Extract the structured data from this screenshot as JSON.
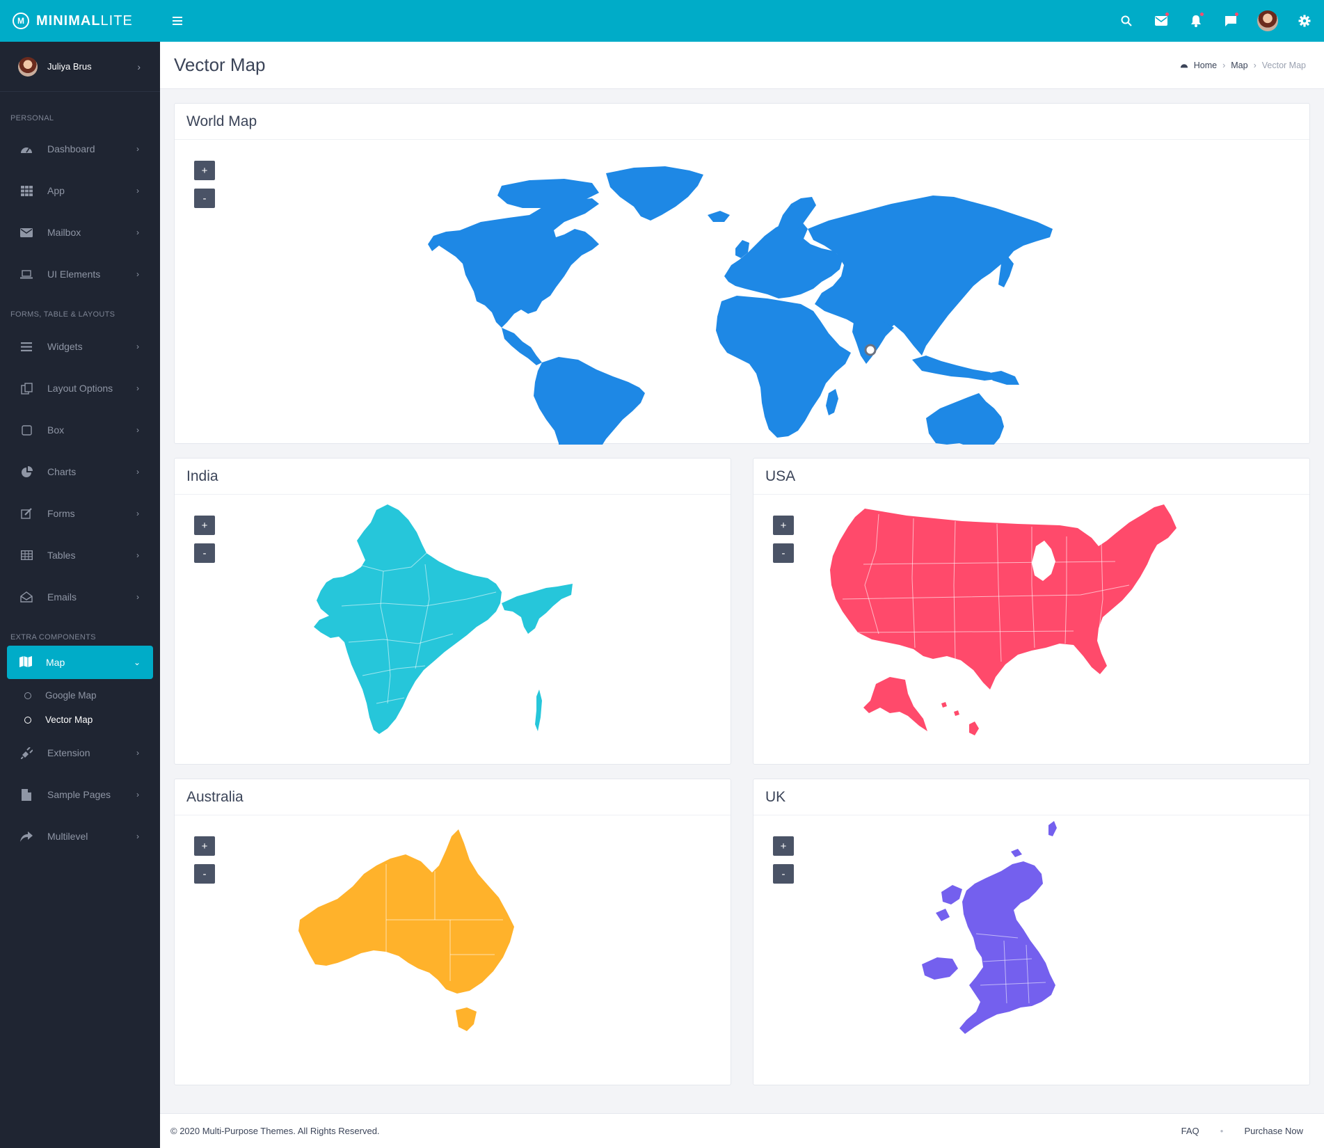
{
  "topbar": {
    "logo_bold": "MINIMAL",
    "logo_light": "LITE",
    "menu_icon": "hamburger-icon",
    "icons": [
      "search-icon",
      "mail-icon",
      "bell-icon",
      "chat-icon",
      "user-avatar",
      "gear-icon"
    ]
  },
  "sidebar": {
    "user_name": "Juliya Brus",
    "section_personal": "PERSONAL",
    "section_forms": "FORMS, TABLE & LAYOUTS",
    "section_extra": "EXTRA COMPONENTS",
    "items": {
      "dashboard": "Dashboard",
      "app": "App",
      "mailbox": "Mailbox",
      "ui_elements": "UI Elements",
      "widgets": "Widgets",
      "layout_options": "Layout Options",
      "box": "Box",
      "charts": "Charts",
      "forms": "Forms",
      "tables": "Tables",
      "emails": "Emails",
      "map": "Map",
      "google_map": "Google Map",
      "vector_map": "Vector Map",
      "extension": "Extension",
      "sample_pages": "Sample Pages",
      "multilevel": "Multilevel"
    }
  },
  "header": {
    "title": "Vector Map",
    "breadcrumb": [
      "Home",
      "Map",
      "Vector Map"
    ]
  },
  "maps": {
    "world": {
      "title": "World Map",
      "color": "#1e88e5"
    },
    "india": {
      "title": "India",
      "color": "#26c6da"
    },
    "usa": {
      "title": "USA",
      "color": "#ff4a6b"
    },
    "australia": {
      "title": "Australia",
      "color": "#ffb22b"
    },
    "uk": {
      "title": "UK",
      "color": "#7460ee"
    },
    "zoom_in": "+",
    "zoom_out": "-"
  },
  "footer": {
    "copyright": "© 2020 Multi-Purpose Themes. All Rights Reserved.",
    "faq": "FAQ",
    "purchase": "Purchase Now"
  },
  "colors": {
    "accent": "#00acc8",
    "sidebar_bg": "#1f2532"
  }
}
